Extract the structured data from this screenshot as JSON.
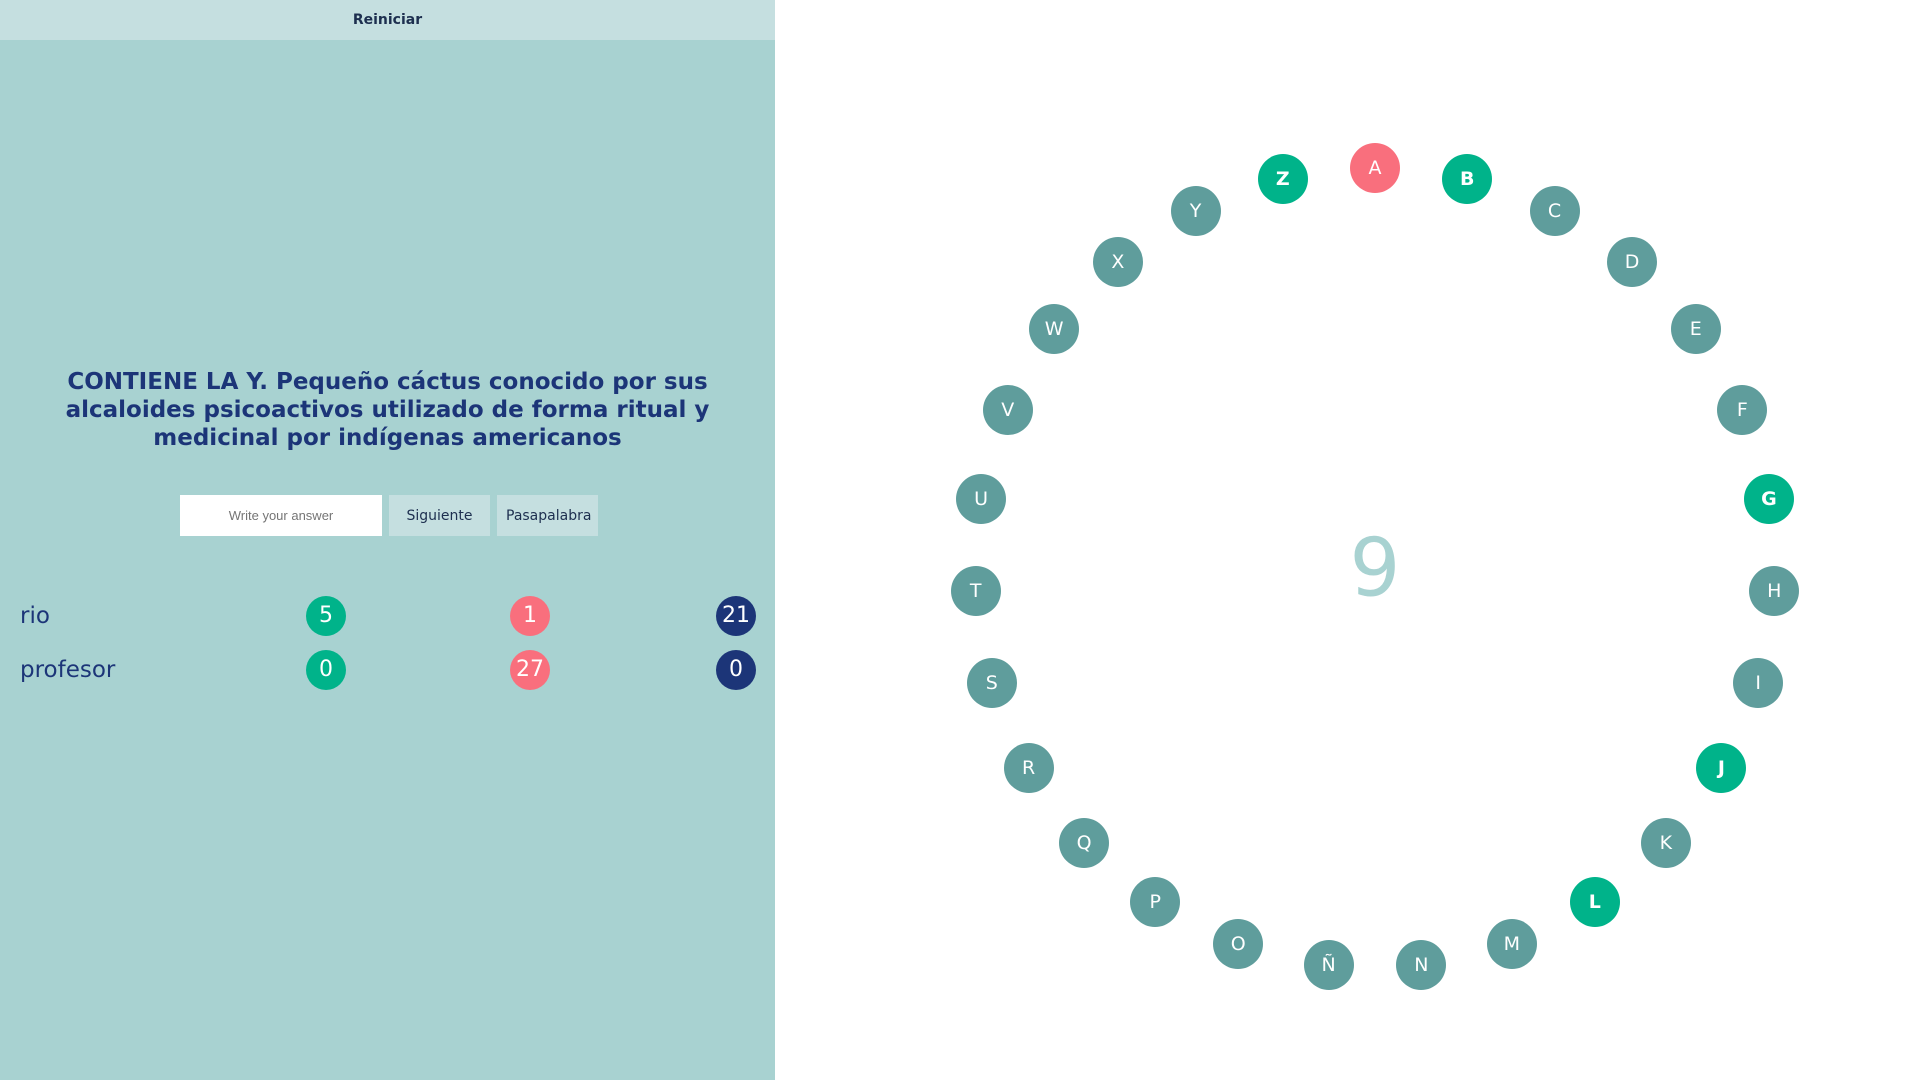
{
  "restart_label": "Reiniciar",
  "question": "CONTIENE LA Y. Pequeño cáctus conocido por sus alcaloides psicoactivos utilizado de forma ritual y medicinal por indígenas americanos",
  "answer": {
    "value": "",
    "placeholder": "Write your answer"
  },
  "buttons": {
    "next": "Siguiente",
    "pass": "Pasapalabra"
  },
  "players": [
    {
      "name": "rio",
      "correct": "5",
      "wrong": "1",
      "pending": "21"
    },
    {
      "name": "profesor",
      "correct": "0",
      "wrong": "27",
      "pending": "0"
    }
  ],
  "timer": "9",
  "colors": {
    "left_panel": "#a8d2d1",
    "button": "#c5dfe0",
    "correct": "#00b38a",
    "wrong": "#f96f7d",
    "current": "#f96f7d",
    "pending": "#5f9d9c",
    "dark_blue": "#1c3578"
  },
  "rosco": [
    {
      "letter": "A",
      "status": "current"
    },
    {
      "letter": "B",
      "status": "correct"
    },
    {
      "letter": "C",
      "status": "pending"
    },
    {
      "letter": "D",
      "status": "pending"
    },
    {
      "letter": "E",
      "status": "pending"
    },
    {
      "letter": "F",
      "status": "pending"
    },
    {
      "letter": "G",
      "status": "correct"
    },
    {
      "letter": "H",
      "status": "pending"
    },
    {
      "letter": "I",
      "status": "pending"
    },
    {
      "letter": "J",
      "status": "correct"
    },
    {
      "letter": "K",
      "status": "pending"
    },
    {
      "letter": "L",
      "status": "correct"
    },
    {
      "letter": "M",
      "status": "pending"
    },
    {
      "letter": "N",
      "status": "pending"
    },
    {
      "letter": "Ñ",
      "status": "pending"
    },
    {
      "letter": "O",
      "status": "pending"
    },
    {
      "letter": "P",
      "status": "pending"
    },
    {
      "letter": "Q",
      "status": "pending"
    },
    {
      "letter": "R",
      "status": "pending"
    },
    {
      "letter": "S",
      "status": "pending"
    },
    {
      "letter": "T",
      "status": "pending"
    },
    {
      "letter": "U",
      "status": "pending"
    },
    {
      "letter": "V",
      "status": "pending"
    },
    {
      "letter": "W",
      "status": "pending"
    },
    {
      "letter": "X",
      "status": "pending"
    },
    {
      "letter": "Y",
      "status": "pending"
    },
    {
      "letter": "Z",
      "status": "correct"
    }
  ]
}
